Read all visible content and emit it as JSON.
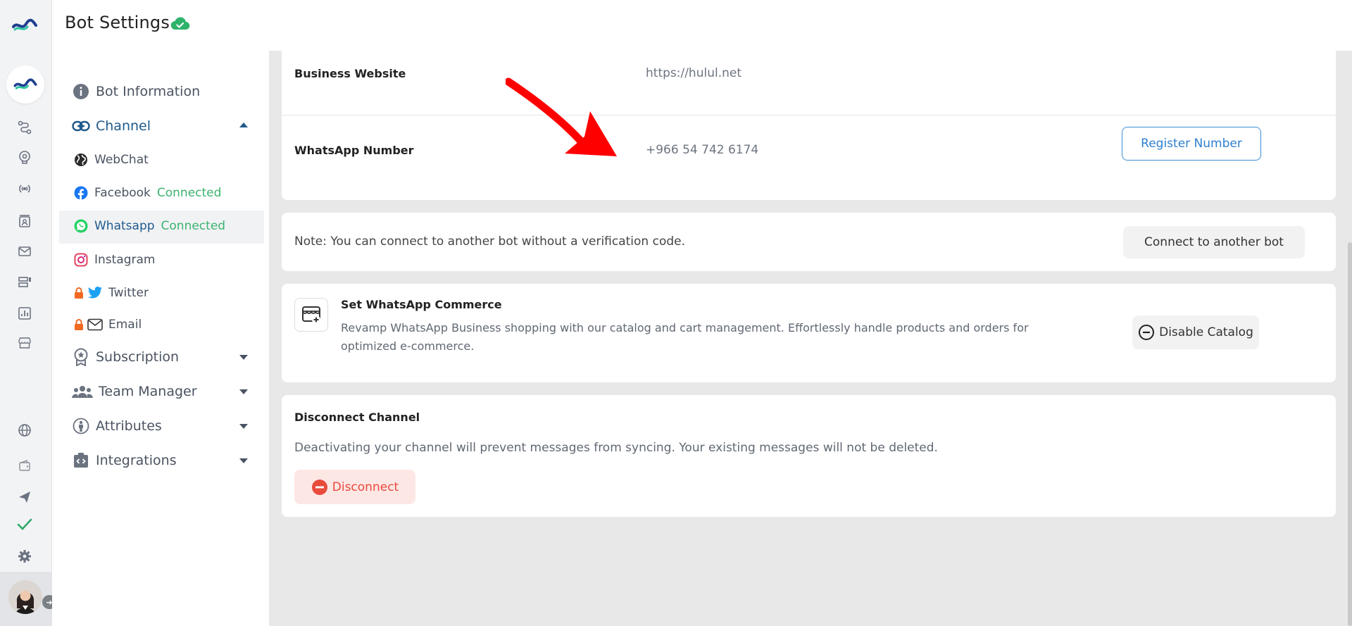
{
  "header": {
    "title": "Bot Settings"
  },
  "rail": {
    "icons": [
      "flow-icon",
      "brain-icon",
      "broadcast-icon",
      "contacts-icon",
      "mail-icon",
      "templates-icon",
      "analytics-icon",
      "store-icon",
      "globe-icon",
      "wallet-icon",
      "send-icon",
      "check-icon",
      "gear-icon"
    ]
  },
  "sidebar": {
    "bot_information": "Bot Information",
    "channel": "Channel",
    "webchat": "WebChat",
    "facebook": "Facebook",
    "facebook_status": "Connected",
    "whatsapp": "Whatsapp",
    "whatsapp_status": "Connected",
    "instagram": "Instagram",
    "twitter": "Twitter",
    "email": "Email",
    "subscription": "Subscription",
    "team_manager": "Team Manager",
    "attributes": "Attributes",
    "integrations": "Integrations"
  },
  "main": {
    "business_website_label": "Business Website",
    "business_website_value": "https://hulul.net",
    "whatsapp_number_label": "WhatsApp Number",
    "whatsapp_number_value": "+966 54 742 6174",
    "register_button": "Register Number",
    "note_text": "Note: You can connect to another bot without a verification code.",
    "connect_button": "Connect to another bot",
    "commerce_title": "Set WhatsApp Commerce",
    "commerce_desc_line1": "Revamp WhatsApp Business shopping with our catalog and cart management. Effortlessly handle products and orders for",
    "commerce_desc_line2": "optimized e-commerce.",
    "disable_catalog_button": "Disable Catalog",
    "disconnect_title": "Disconnect Channel",
    "disconnect_desc": "Deactivating your channel will prevent messages from syncing. Your existing messages will not be deleted.",
    "disconnect_button": "Disconnect"
  },
  "colors": {
    "accent_blue": "#2f80cf",
    "connected_green": "#3bb36f",
    "danger_red": "#e84b3c",
    "annotation_red": "#ff0000"
  }
}
